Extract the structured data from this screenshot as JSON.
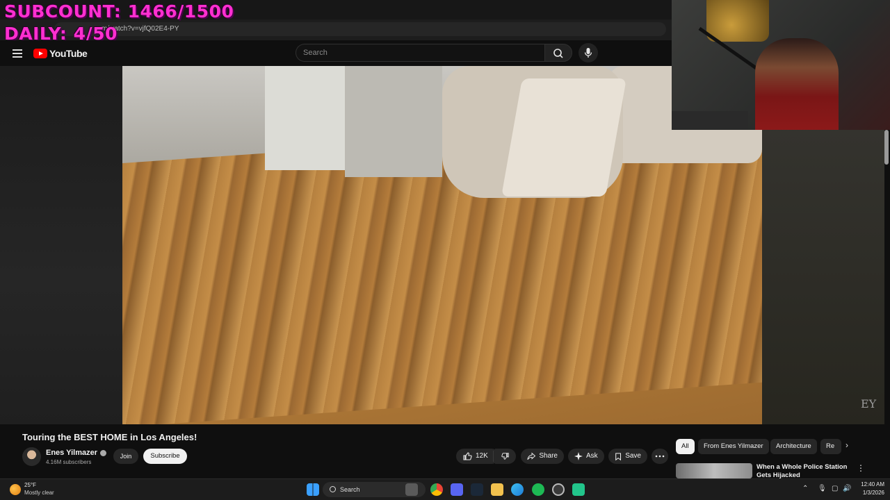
{
  "overlay": {
    "subcount": "SUBCOUNT: 1466/1500",
    "daily": "DAILY: 4/50"
  },
  "browser": {
    "url": "m/watch?v=vjfQ02E4-PY"
  },
  "youtube": {
    "logo_text": "YouTube",
    "search_placeholder": "Search"
  },
  "video": {
    "watermark": "EY"
  },
  "info": {
    "title": "Touring the BEST HOME in Los Angeles!",
    "channel_name": "Enes Yilmazer",
    "subscribers": "4.16M subscribers",
    "join_label": "Join",
    "subscribe_label": "Subscribe",
    "like_count": "12K",
    "share_label": "Share",
    "ask_label": "Ask",
    "save_label": "Save"
  },
  "chips": {
    "items": [
      "All",
      "From Enes Yilmazer",
      "Architecture",
      "Re"
    ]
  },
  "recommendation": {
    "title": "When a Whole Police Station Gets Hijacked"
  },
  "taskbar": {
    "temperature": "25°F",
    "weather": "Mostly clear",
    "search_label": "Search",
    "time": "12:40 AM",
    "date": "1/3/2026"
  },
  "colors": {
    "overlay": "#ff2fd0",
    "youtube_red": "#ff0000",
    "background": "#0f0f0f"
  }
}
